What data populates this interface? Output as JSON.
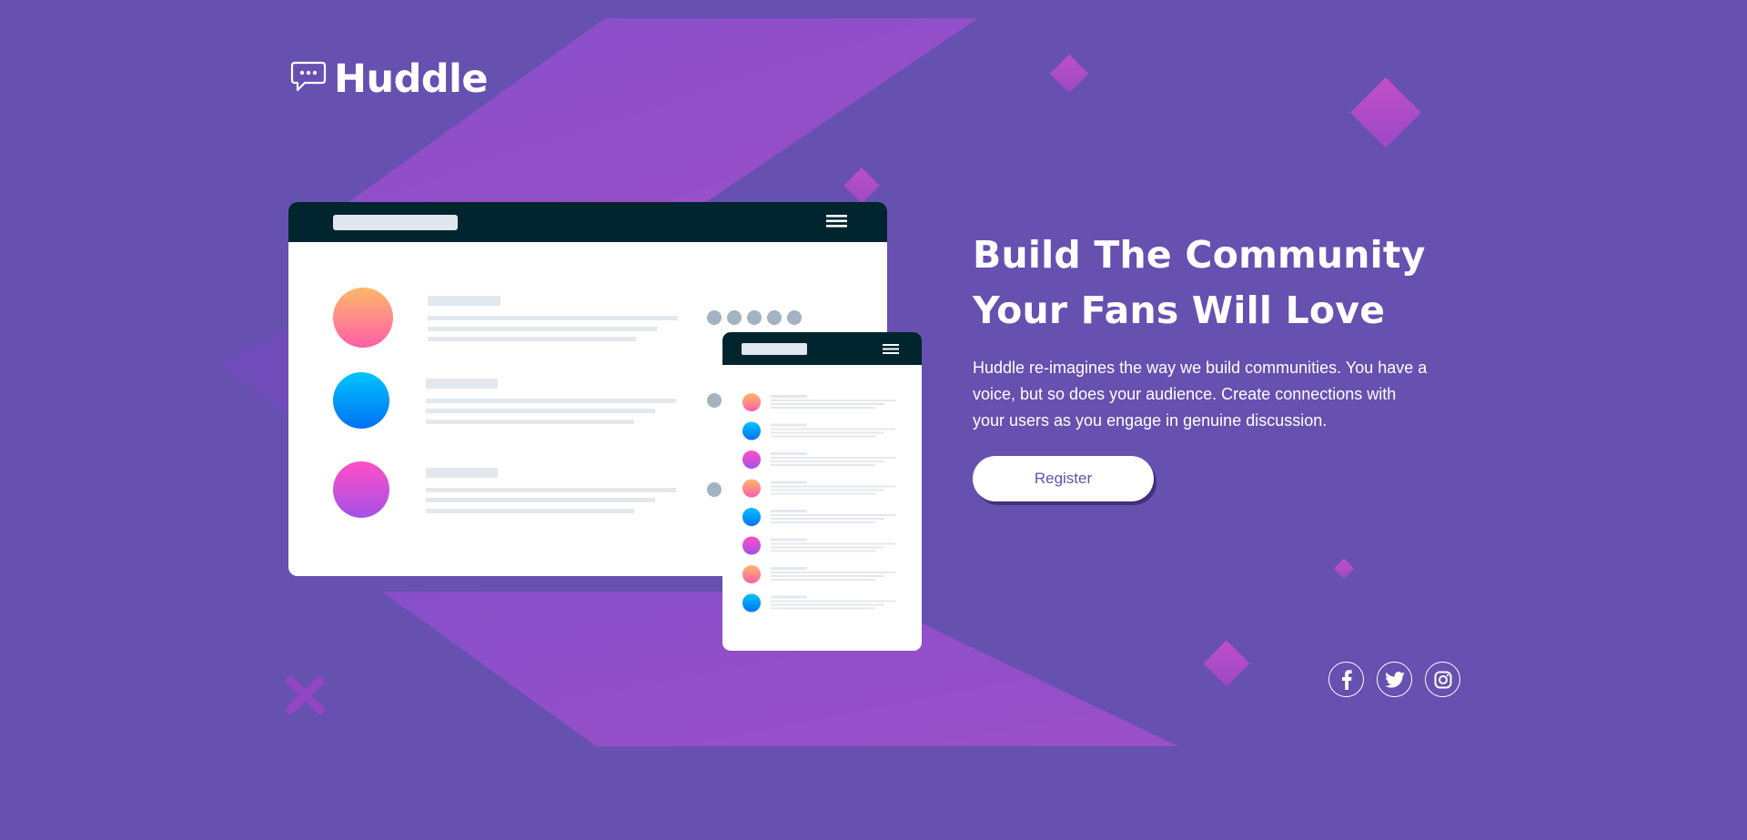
{
  "brand": {
    "name": "Huddle",
    "logo_icon": "speech-bubble-icon"
  },
  "hero": {
    "title_line1": "Build The Community",
    "title_line2": "Your Fans Will Love",
    "description": "Huddle re-imagines the way we build communities. You have a voice, but so does your audience. Create connections with your users as you engage in genuine discussion.",
    "register_label": "Register"
  },
  "socials": [
    {
      "name": "facebook",
      "icon": "facebook-icon"
    },
    {
      "name": "twitter",
      "icon": "twitter-icon"
    },
    {
      "name": "instagram",
      "icon": "instagram-icon"
    }
  ],
  "colors": {
    "background": "#6650b0",
    "accent": "#9b4fcb",
    "mockup_bar": "#00252e",
    "button_text": "#6650b0"
  }
}
